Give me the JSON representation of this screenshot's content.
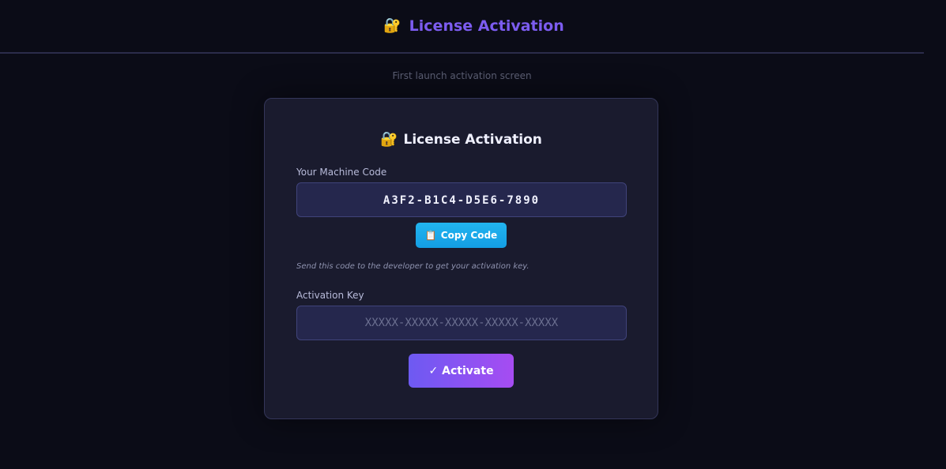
{
  "header": {
    "icon": "locked-with-key-icon",
    "icon_glyph": "🔐",
    "title": "License Activation",
    "subtitle": "First launch activation screen"
  },
  "card": {
    "icon": "locked-with-key-icon",
    "icon_glyph": "🔐",
    "title": "License Activation",
    "machine_code_label": "Your Machine Code",
    "machine_code": "A3F2-B1C4-D5E6-7890",
    "copy_button": {
      "icon": "clipboard-icon",
      "icon_glyph": "📋",
      "label": "Copy Code"
    },
    "hint": "Send this code to the developer to get your activation key.",
    "activation_key_label": "Activation Key",
    "activation_key_placeholder": "XXXXX-XXXXX-XXXXX-XXXXX-XXXXX",
    "activation_key_value": "",
    "activate_button": {
      "icon": "check-icon",
      "icon_glyph": "✓",
      "label": "Activate"
    }
  },
  "colors": {
    "background": "#0b0c17",
    "header_title": "#7c5cf0",
    "card_background": "#1a1b2e",
    "input_background": "#25274d",
    "copy_button": "#18a8ea",
    "activate_gradient_start": "#6d5af2",
    "activate_gradient_end": "#a64cf2"
  }
}
